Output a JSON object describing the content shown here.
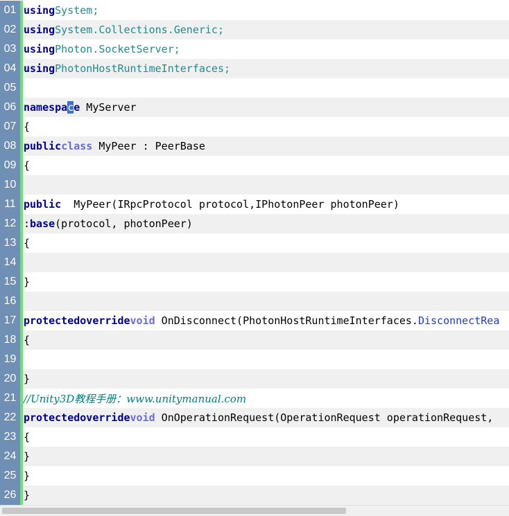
{
  "lines": [
    {
      "num": "01",
      "tokens": [
        [
          "kw",
          "using"
        ],
        [
          "type",
          "System;"
        ]
      ]
    },
    {
      "num": "02",
      "tokens": [
        [
          "kw",
          "using"
        ],
        [
          "type",
          "System.Collections.Generic;"
        ]
      ]
    },
    {
      "num": "03",
      "tokens": [
        [
          "kw",
          "using"
        ],
        [
          "type",
          "Photon.SocketServer;"
        ]
      ]
    },
    {
      "num": "04",
      "tokens": [
        [
          "kw",
          "using"
        ],
        [
          "type",
          "PhotonHostRuntimeInterfaces;"
        ]
      ]
    },
    {
      "num": "05",
      "tokens": []
    },
    {
      "num": "06",
      "tokens": [
        [
          "kw",
          "namespa"
        ],
        [
          "sel",
          "c"
        ],
        [
          "kw",
          "e"
        ],
        [
          "plain",
          " MyServer"
        ]
      ]
    },
    {
      "num": "07",
      "tokens": [
        [
          "plain",
          "{"
        ]
      ]
    },
    {
      "num": "08",
      "tokens": [
        [
          "kw",
          "public"
        ],
        [
          "kw2",
          "class"
        ],
        [
          "plain",
          " MyPeer : PeerBase"
        ]
      ]
    },
    {
      "num": "09",
      "tokens": [
        [
          "plain",
          "{"
        ]
      ]
    },
    {
      "num": "10",
      "tokens": []
    },
    {
      "num": "11",
      "tokens": [
        [
          "kw",
          "public"
        ],
        [
          "plain",
          "  MyPeer(IRpcProtocol protocol,IPhotonPeer photonPeer)"
        ]
      ]
    },
    {
      "num": "12",
      "tokens": [
        [
          "plain",
          ":"
        ],
        [
          "kw",
          "base"
        ],
        [
          "plain",
          "(protocol, photonPeer)"
        ]
      ]
    },
    {
      "num": "13",
      "tokens": [
        [
          "plain",
          "{"
        ]
      ]
    },
    {
      "num": "14",
      "tokens": []
    },
    {
      "num": "15",
      "tokens": [
        [
          "plain",
          "}"
        ]
      ]
    },
    {
      "num": "16",
      "tokens": []
    },
    {
      "num": "17",
      "tokens": [
        [
          "kw",
          "protected"
        ],
        [
          "kw",
          "override"
        ],
        [
          "kw2",
          "void"
        ],
        [
          "plain",
          " OnDisconnect(PhotonHostRuntimeInterfaces."
        ],
        [
          "member",
          "DisconnectRea"
        ]
      ]
    },
    {
      "num": "18",
      "tokens": [
        [
          "plain",
          "{"
        ]
      ]
    },
    {
      "num": "19",
      "tokens": []
    },
    {
      "num": "20",
      "tokens": [
        [
          "plain",
          "}"
        ]
      ]
    },
    {
      "num": "21",
      "tokens": [
        [
          "comment",
          "//Unity3D教程手册：www.unitymanual.com"
        ]
      ]
    },
    {
      "num": "22",
      "tokens": [
        [
          "kw",
          "protected"
        ],
        [
          "kw",
          "override"
        ],
        [
          "kw2",
          "void"
        ],
        [
          "plain",
          " OnOperationRequest(OperationRequest operationRequest,"
        ]
      ]
    },
    {
      "num": "23",
      "tokens": [
        [
          "plain",
          "{"
        ]
      ]
    },
    {
      "num": "24",
      "tokens": [
        [
          "plain",
          "}"
        ]
      ]
    },
    {
      "num": "25",
      "tokens": [
        [
          "plain",
          "}"
        ]
      ]
    },
    {
      "num": "26",
      "tokens": [
        [
          "plain",
          "}"
        ]
      ]
    }
  ]
}
